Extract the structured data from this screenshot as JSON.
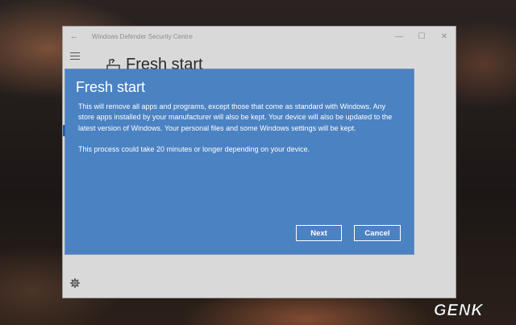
{
  "window": {
    "title": "Windows Defender Security Centre",
    "back_icon": "back-arrow-icon",
    "minimize_glyph": "—",
    "maximize_glyph": "☐",
    "close_glyph": "✕"
  },
  "page": {
    "title": "Fresh start",
    "icon": "fresh-start-icon"
  },
  "dialog": {
    "title": "Fresh start",
    "paragraph1": "This will remove all apps and programs, except those that come as standard with Windows. Any store apps installed by your manufacturer will also be kept. Your device will also be updated to the latest version of Windows. Your personal files and some Windows settings will be kept.",
    "paragraph2": "This process could take 20 minutes or longer depending on your device.",
    "next_label": "Next",
    "cancel_label": "Cancel"
  },
  "watermark": {
    "text": "GENK"
  },
  "colors": {
    "dialog_bg": "#4b82c2",
    "window_bg": "#d9d9d9",
    "accent": "#1e5fb3"
  }
}
